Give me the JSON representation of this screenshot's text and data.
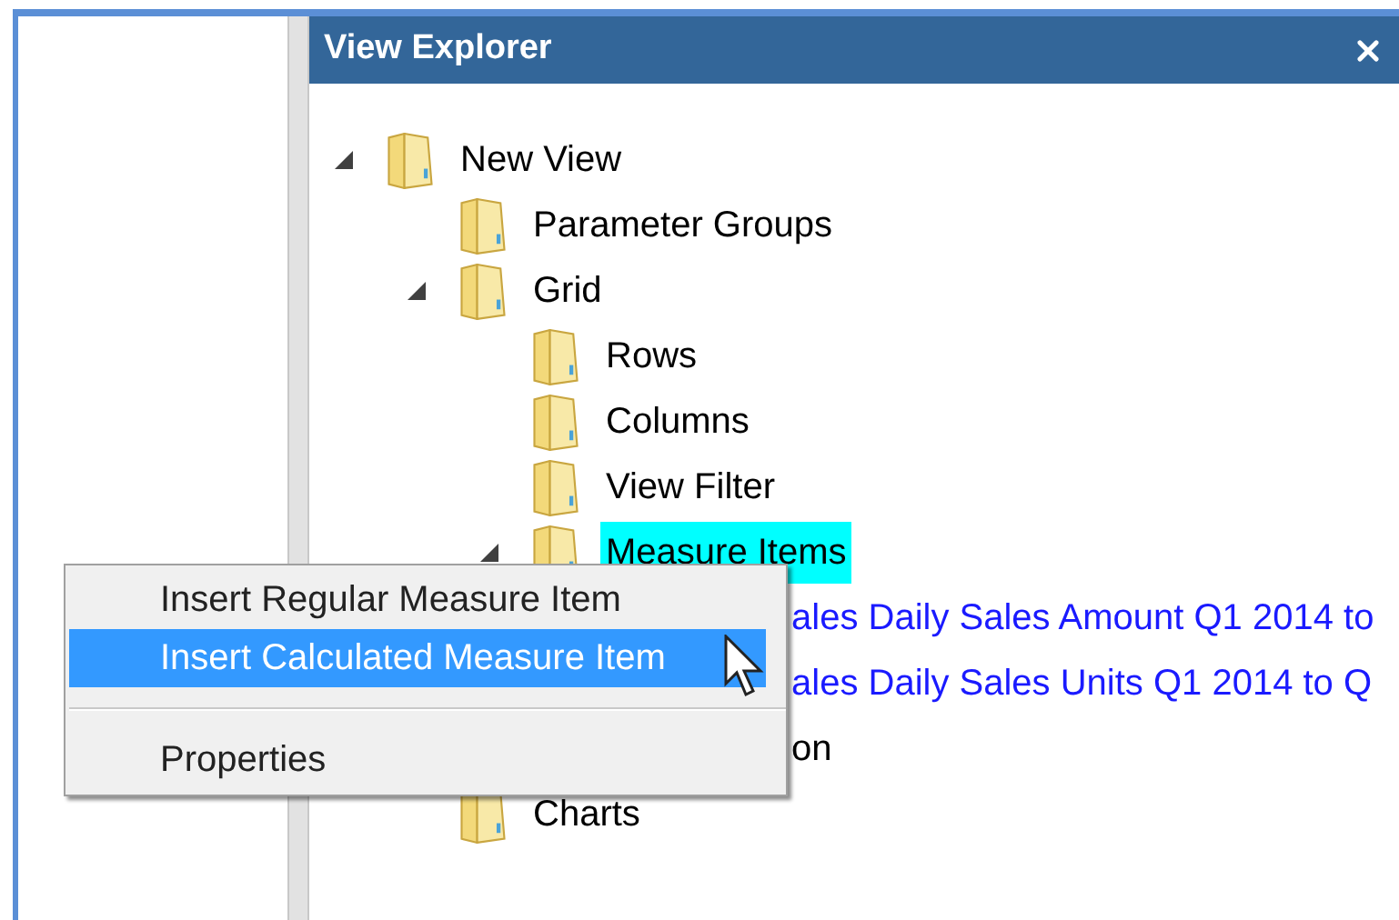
{
  "panel": {
    "title": "View Explorer"
  },
  "tree": [
    {
      "kind": "node",
      "label": "New View",
      "expanded": true,
      "selected": false,
      "children": [
        {
          "kind": "node",
          "label": "Parameter Groups",
          "selected": false
        },
        {
          "kind": "node",
          "label": "Grid",
          "expanded": true,
          "selected": false,
          "children": [
            {
              "kind": "node",
              "label": "Rows",
              "selected": false
            },
            {
              "kind": "node",
              "label": "Columns",
              "selected": false
            },
            {
              "kind": "node",
              "label": "View Filter",
              "selected": false
            },
            {
              "kind": "node",
              "label": "Measure Items",
              "expanded": true,
              "selected": true,
              "children": [
                {
                  "kind": "covered",
                  "label": "ales Daily Sales Amount Q1 2014 to",
                  "link": true
                },
                {
                  "kind": "covered",
                  "label": "ales Daily Sales Units Q1 2014 to Q",
                  "link": true
                }
              ]
            },
            {
              "kind": "covered",
              "label": "on",
              "link": false
            }
          ]
        },
        {
          "kind": "node",
          "label": "Charts",
          "selected": false
        }
      ]
    }
  ],
  "context_menu": [
    {
      "kind": "item",
      "label": "Insert Regular Measure Item",
      "selected": false
    },
    {
      "kind": "item",
      "label": "Insert Calculated Measure Item",
      "selected": true
    },
    {
      "kind": "separator"
    },
    {
      "kind": "item",
      "label": "Properties",
      "selected": false
    }
  ]
}
